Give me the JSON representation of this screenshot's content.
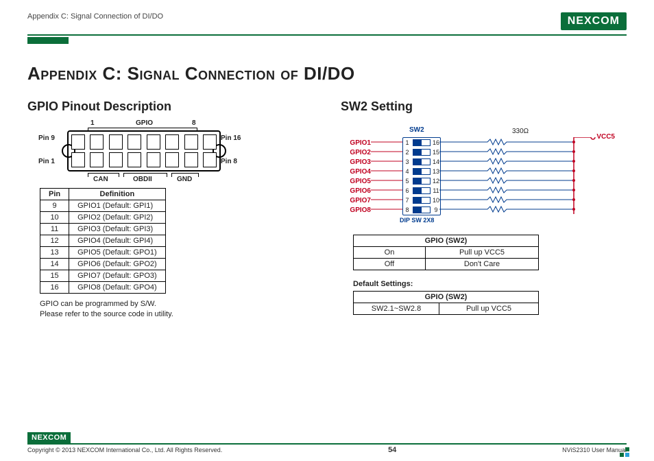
{
  "header": {
    "breadcrumb": "Appendix C: Signal Connection of DI/DO",
    "logo": "NEXCOM"
  },
  "title": "Appendix C: Signal Connection of DI/DO",
  "left": {
    "heading": "GPIO Pinout Description",
    "connector": {
      "top_left": "Pin 9",
      "top_right": "Pin 16",
      "bot_left": "Pin 1",
      "bot_right": "Pin 8",
      "num_left": "1",
      "top_label": "GPIO",
      "num_right": "8",
      "bot_label_left": "CAN",
      "bot_label_mid": "OBDII",
      "bot_label_right": "GND"
    },
    "table": {
      "h1": "Pin",
      "h2": "Definition",
      "rows": [
        {
          "pin": "9",
          "def": "GPIO1 (Default: GPI1)"
        },
        {
          "pin": "10",
          "def": "GPIO2 (Default: GPI2)"
        },
        {
          "pin": "11",
          "def": "GPIO3 (Default: GPI3)"
        },
        {
          "pin": "12",
          "def": "GPIO4 (Default: GPI4)"
        },
        {
          "pin": "13",
          "def": "GPIO5 (Default: GPO1)"
        },
        {
          "pin": "14",
          "def": "GPIO6 (Default: GPO2)"
        },
        {
          "pin": "15",
          "def": "GPIO7 (Default: GPO3)"
        },
        {
          "pin": "16",
          "def": "GPIO8 (Default: GPO4)"
        }
      ]
    },
    "note1": "GPIO can be programmed by S/W.",
    "note2": "Please refer to the source code in utility."
  },
  "right": {
    "heading": "SW2 Setting",
    "schematic": {
      "sw_title": "SW2",
      "dip_sub": "DIP SW 2X8",
      "gpio": [
        "GPIO1",
        "GPIO2",
        "GPIO3",
        "GPIO4",
        "GPIO5",
        "GPIO6",
        "GPIO7",
        "GPIO8"
      ],
      "left_nums": [
        "1",
        "2",
        "3",
        "4",
        "5",
        "6",
        "7",
        "8"
      ],
      "right_nums": [
        "16",
        "15",
        "14",
        "13",
        "12",
        "11",
        "10",
        "9"
      ],
      "r_label": "330Ω",
      "vcc": "VCC5"
    },
    "table1": {
      "header": "GPIO (SW2)",
      "rows": [
        {
          "a": "On",
          "b": "Pull up VCC5"
        },
        {
          "a": "Off",
          "b": "Don't Care"
        }
      ]
    },
    "default_hdr": "Default Settings:",
    "table2": {
      "header": "GPIO (SW2)",
      "rows": [
        {
          "a": "SW2.1~SW2.8",
          "b": "Pull up VCC5"
        }
      ]
    }
  },
  "footer": {
    "logo": "NEXCOM",
    "copyright": "Copyright © 2013 NEXCOM International Co., Ltd. All Rights Reserved.",
    "page": "54",
    "manual": "NViS2310 User Manual"
  }
}
